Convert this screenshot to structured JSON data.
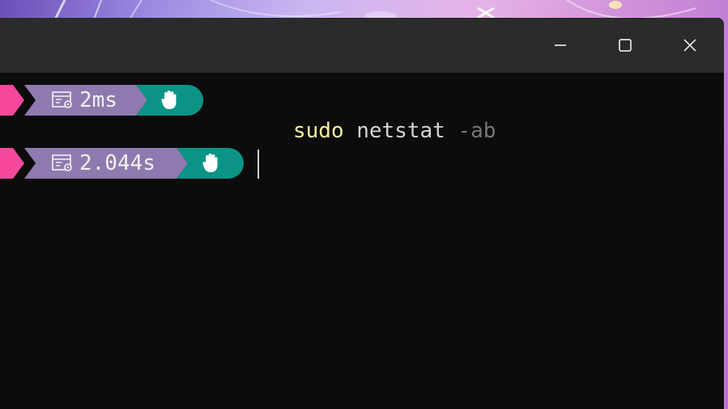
{
  "colors": {
    "pink_segment": "#f5489c",
    "duration_segment": "#8f7ab0",
    "status_segment": "#0b9486",
    "terminal_bg": "#0c0c0c",
    "titlebar_bg": "#2b2b2b",
    "exec_color": "#f9f1a5",
    "flag_color": "#767676"
  },
  "window_controls": {
    "minimize": "minimize-icon",
    "maximize": "maximize-icon",
    "close": "close-icon"
  },
  "prompt_lines": [
    {
      "duration": "2ms",
      "duration_icon": "executiontime-icon",
      "status_icon": "hand-icon",
      "command": {
        "exec": "sudo",
        "arg": "netstat",
        "flag": "-ab"
      }
    },
    {
      "duration": "2.044s",
      "duration_icon": "executiontime-icon",
      "status_icon": "hand-icon",
      "command": null
    }
  ]
}
